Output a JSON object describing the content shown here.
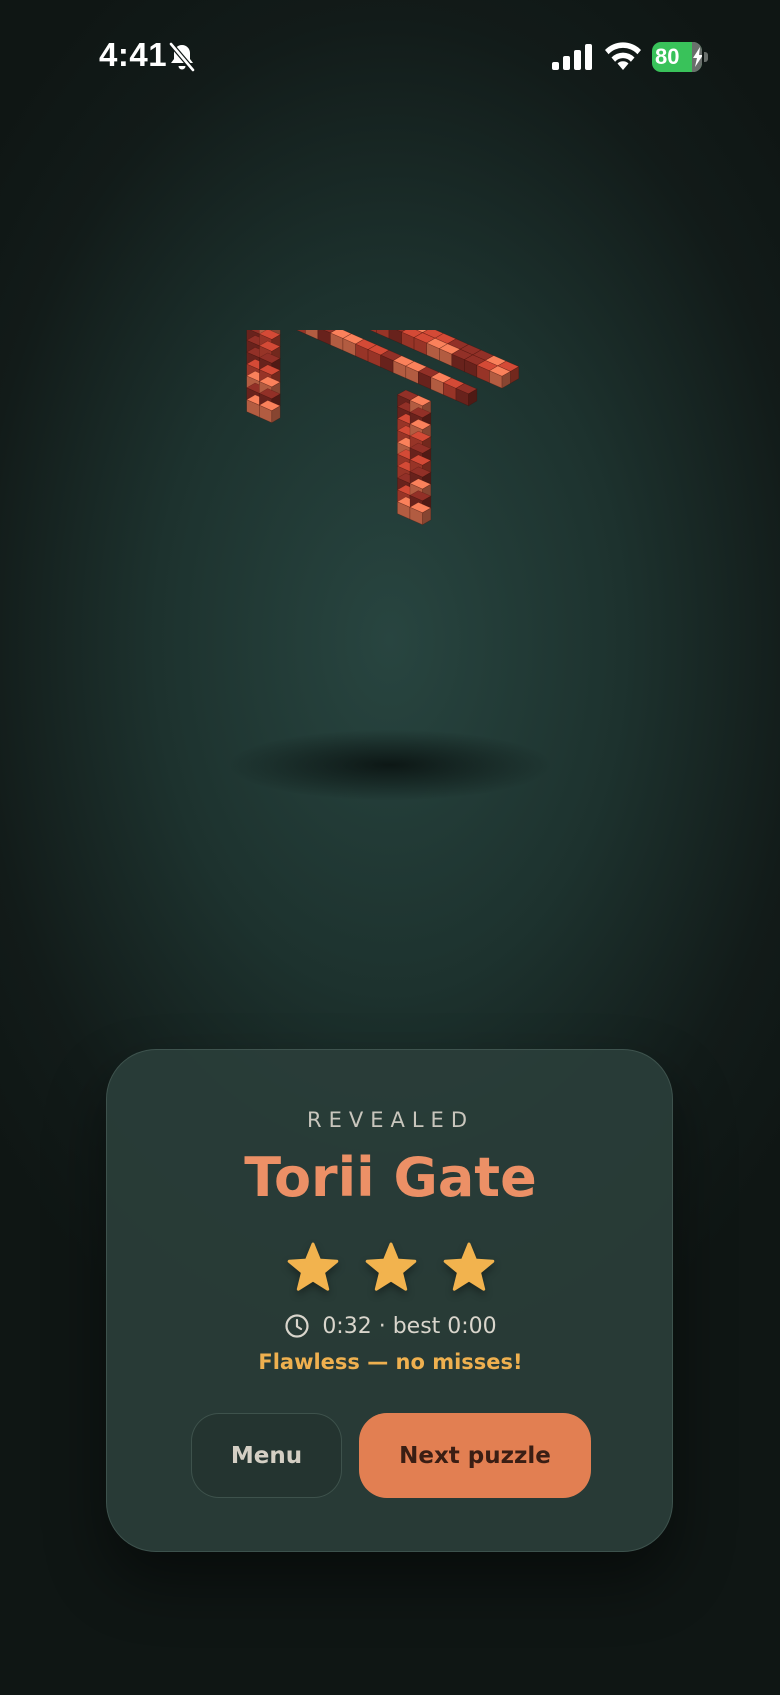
{
  "status_bar": {
    "time": "4:41",
    "battery_percent": "80",
    "battery_level": 0.8,
    "icons": [
      "bell-slash-icon",
      "signal-icon",
      "wifi-icon",
      "battery-icon",
      "charging-bolt-icon"
    ]
  },
  "scene": {
    "model_icon": "torii-gate-voxel-model",
    "colors": {
      "voxel_light": "#d9704f",
      "voxel_mid": "#b8402f",
      "voxel_dark": "#7f2a22",
      "background_center": "#284540",
      "background_edge": "#0f1614"
    }
  },
  "result": {
    "label": "REVEALED",
    "title": "Torii Gate",
    "stars_earned": 3,
    "stars_total": 3,
    "time_text": "0:32 · best 0:00",
    "message": "Flawless — no misses!",
    "menu_label": "Menu",
    "next_label": "Next puzzle",
    "colors": {
      "title": "#ec9066",
      "stars": "#f2b34e",
      "message": "#efb04f",
      "next_button": "#e27f52"
    }
  }
}
